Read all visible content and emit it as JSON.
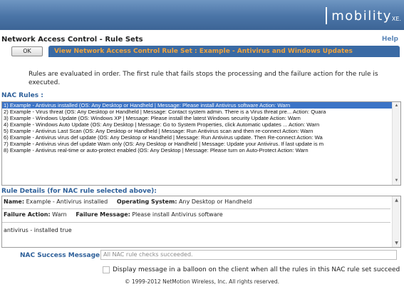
{
  "branding": {
    "logo_text": "mobility",
    "logo_suffix": "XE."
  },
  "header": {
    "page_title": "Network Access Control - Rule Sets",
    "help_label": "Help",
    "ok_label": "OK",
    "ruleset_title": "View Network Access Control Rule Set  :  Example - Antivirus and Windows Updates"
  },
  "note": "Rules are evaluated in order. The first rule that fails stops the processing and the failure action for the rule is executed.",
  "rules_section": {
    "label": "NAC Rules :",
    "selected_index": 0,
    "items": [
      "1) Example - Antivirus installed (OS: Any Desktop or Handheld | Message: Please install Antivirus software Action: Warn",
      "2) Example - Virus threat (OS: Any Desktop or Handheld | Message: Contact system admin. There is a Virus threat pre... Action: Quara",
      "3) Example - Windows Update (OS: Windows XP | Message: Please install the latest Windows security Update Action: Warn",
      "4) Example - Windows Auto Update (OS: Any Desktop | Message: Go to System Properties, click Automatic updates ... Action: Warn",
      "5) Example - Antivirus Last Scan (OS: Any Desktop or Handheld | Message: Run Antivirus scan and then re-connect Action: Warn",
      "6) Example - Antivirus virus def update (OS: Any Desktop or Handheld | Message: Run Antivirus update. Then Re-connect Action: Wa",
      "7) Example - Antivirus virus def update Warn only (OS: Any Desktop or Handheld | Message: Update your Antivirus. If last update is m",
      "8) Example - Antivirus real-time or auto-protect enabled (OS: Any Desktop | Message: Please turn on Auto-Protect Action: Warn"
    ]
  },
  "details_section": {
    "label": "Rule Details (for NAC rule selected above):",
    "name_label": "Name:",
    "name_value": "Example - Antivirus installed",
    "os_label": "Operating System:",
    "os_value": "Any Desktop or Handheld",
    "failure_action_label": "Failure Action:",
    "failure_action_value": "Warn",
    "failure_message_label": "Failure Message:",
    "failure_message_value": "Please install Antivirus software",
    "condition": "antivirus - installed true"
  },
  "success": {
    "label": "NAC Success Message:",
    "value": "All NAC rule checks succeeded.",
    "checkbox_label": "Display message in a balloon on the client when all the rules in this NAC rule set succeed",
    "checked": false
  },
  "footer": {
    "copyright": "© 1999-2012 NetMotion Wireless, Inc. All rights reserved."
  },
  "colors": {
    "banner": "#4a74a6",
    "ruleset_header_bg": "#3a6aa4",
    "ruleset_header_text": "#f2a43b",
    "section_label": "#2d5f99",
    "selected_row": "#3c74c6",
    "help_link": "#5b86b8"
  }
}
